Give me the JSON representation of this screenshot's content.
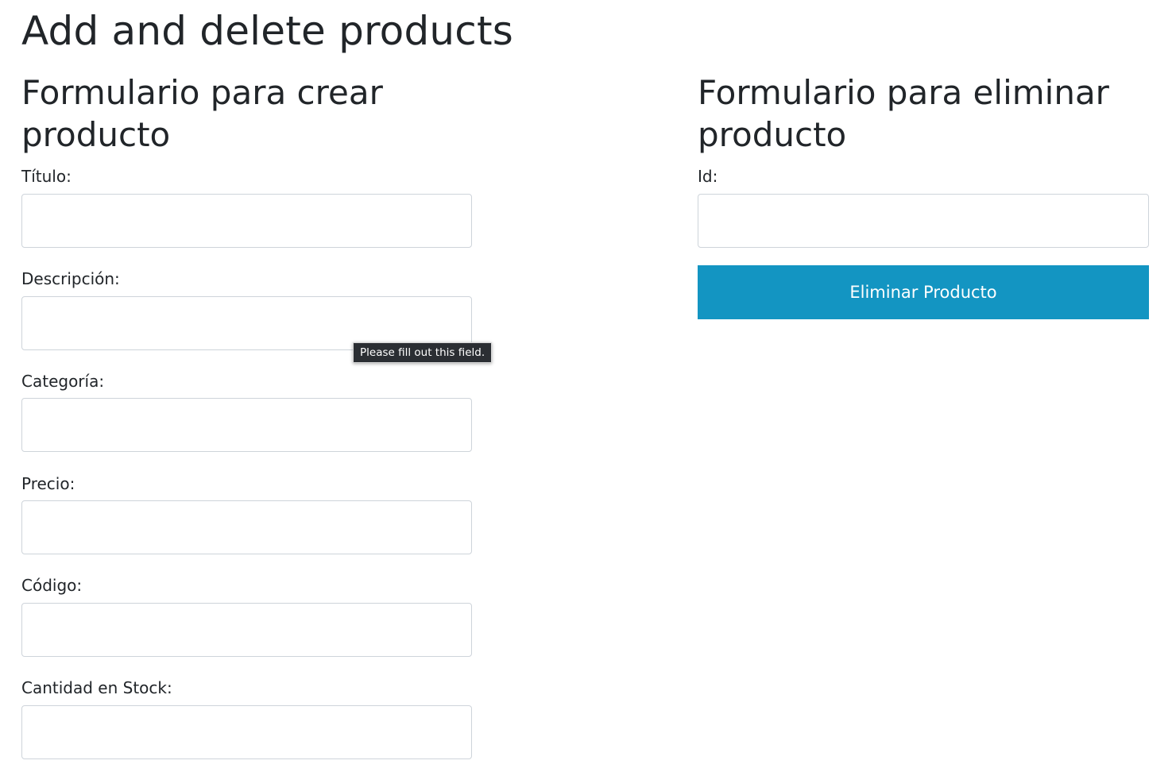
{
  "page": {
    "title": "Add and delete products"
  },
  "create_form": {
    "title": "Formulario para crear producto",
    "fields": [
      {
        "label": "Título:",
        "value": "",
        "placeholder": ""
      },
      {
        "label": "Descripción:",
        "value": "",
        "placeholder": ""
      },
      {
        "label": "Categoría:",
        "value": "",
        "placeholder": ""
      },
      {
        "label": "Precio:",
        "value": "",
        "placeholder": ""
      },
      {
        "label": "Código:",
        "value": "",
        "placeholder": ""
      },
      {
        "label": "Cantidad en Stock:",
        "value": "",
        "placeholder": ""
      }
    ]
  },
  "delete_form": {
    "title": "Formulario para eliminar producto",
    "id_label": "Id:",
    "id_value": "",
    "id_placeholder": "",
    "submit_label": "Eliminar Producto"
  },
  "validation_tooltip": {
    "text": "Please fill out this field."
  },
  "colors": {
    "primary_button": "#1395c2",
    "text": "#212529",
    "input_border": "#ced4da",
    "tooltip_bg": "#2b2e33"
  }
}
